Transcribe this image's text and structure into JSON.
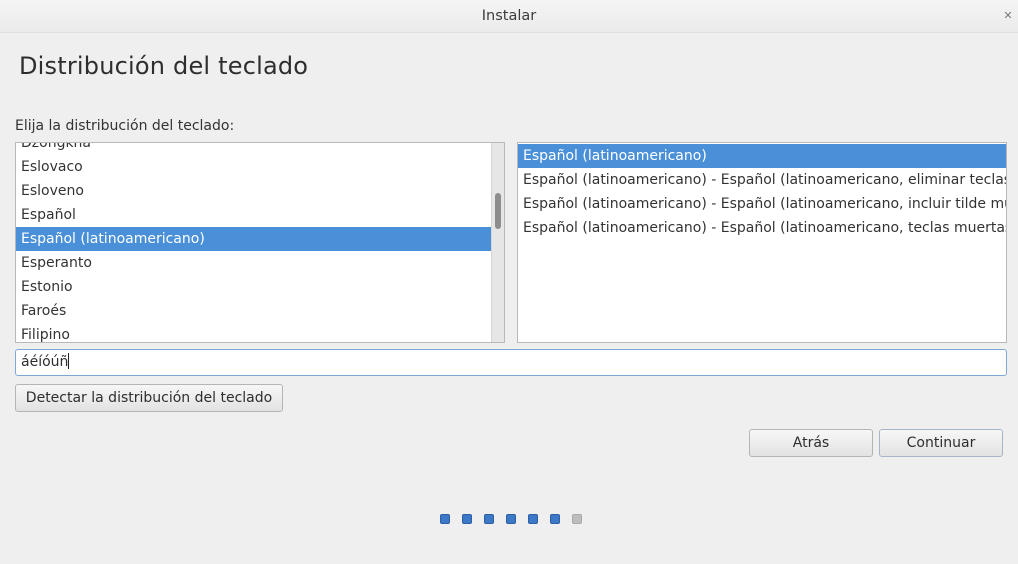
{
  "window": {
    "title": "Instalar",
    "close_glyph": "✕"
  },
  "page": {
    "heading": "Distribución del teclado",
    "prompt": "Elija la distribución del teclado:"
  },
  "layout_list": {
    "items": [
      "Dzongkha",
      "Eslovaco",
      "Esloveno",
      "Español",
      "Español (latinoamericano)",
      "Esperanto",
      "Estonio",
      "Faroés",
      "Filipino"
    ],
    "selected_index": 4
  },
  "variant_list": {
    "items": [
      "Español (latinoamericano)",
      "Español (latinoamericano) - Español (latinoamericano, eliminar teclas muertas)",
      "Español (latinoamericano) - Español (latinoamericano, incluir tilde muerta)",
      "Español (latinoamericano) - Español (latinoamericano, teclas muertas de Sun)"
    ],
    "selected_index": 0
  },
  "test_field": {
    "value": "áéíóúñ"
  },
  "buttons": {
    "detect": "Detectar la distribución del teclado",
    "back": "Atrás",
    "continue": "Continuar"
  },
  "progress": {
    "total_steps": 7,
    "completed_steps": 6,
    "active_color": "#3b78c7",
    "inactive_color": "#bdbdbd"
  },
  "colors": {
    "selection": "#4a90d9",
    "background": "#efefef"
  }
}
